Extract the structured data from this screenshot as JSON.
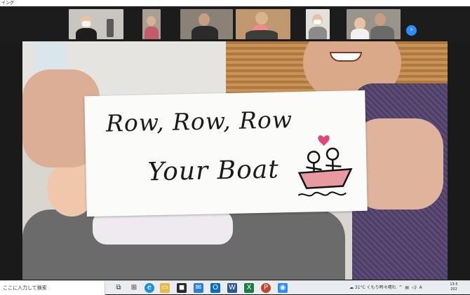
{
  "window": {
    "title": "イング"
  },
  "gallery": {
    "thumbnails": [
      {
        "id": "participant-1"
      },
      {
        "id": "participant-2"
      },
      {
        "id": "participant-3"
      },
      {
        "id": "participant-4"
      },
      {
        "id": "participant-5"
      },
      {
        "id": "participant-6"
      }
    ],
    "next_icon": "›"
  },
  "card": {
    "line1": "Row, Row, Row",
    "line2": "Your Boat"
  },
  "taskbar": {
    "search_placeholder": "ここに入力して検索",
    "weather": "31°C くもり時々晴れ",
    "time": "13:5",
    "date": "202"
  },
  "colors": {
    "accent": "#2d8cff",
    "heart": "#e0457b",
    "boat": "#e89aa0"
  }
}
